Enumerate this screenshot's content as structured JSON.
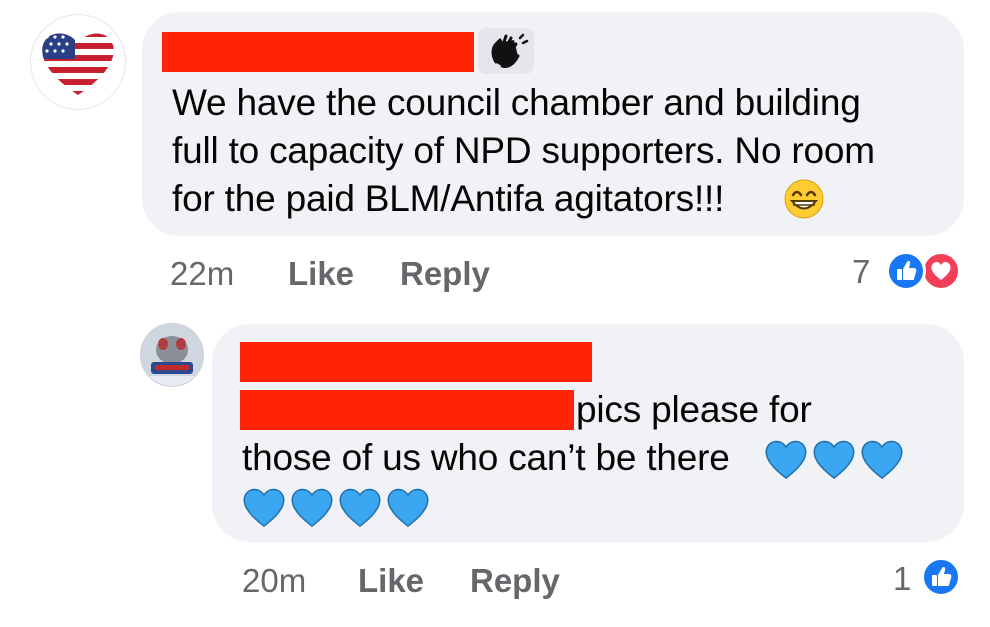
{
  "comments": [
    {
      "text_lines": [
        "We have the council chamber and building",
        "full to capacity of NPD supporters.  No room",
        "for the paid BLM/Antifa agitators!!!"
      ],
      "time": "22m",
      "like_label": "Like",
      "reply_label": "Reply",
      "reaction_count": "7",
      "reactions": [
        "like-icon",
        "love-icon"
      ],
      "emoji": "grinning-emoji"
    },
    {
      "text_lines": [
        "pics please for",
        "those of us who can’t be there"
      ],
      "time": "20m",
      "like_label": "Like",
      "reply_label": "Reply",
      "reaction_count": "1",
      "reactions": [
        "like-icon"
      ],
      "emoji": "blue-heart-emoji"
    }
  ],
  "colors": {
    "bubble": "#f0f2f5",
    "redaction": "#fe2405",
    "meta_text": "#65676b",
    "like_blue": "#1877f2",
    "love_red": "#f33e58",
    "heart_blue": "#3aa7f0"
  }
}
